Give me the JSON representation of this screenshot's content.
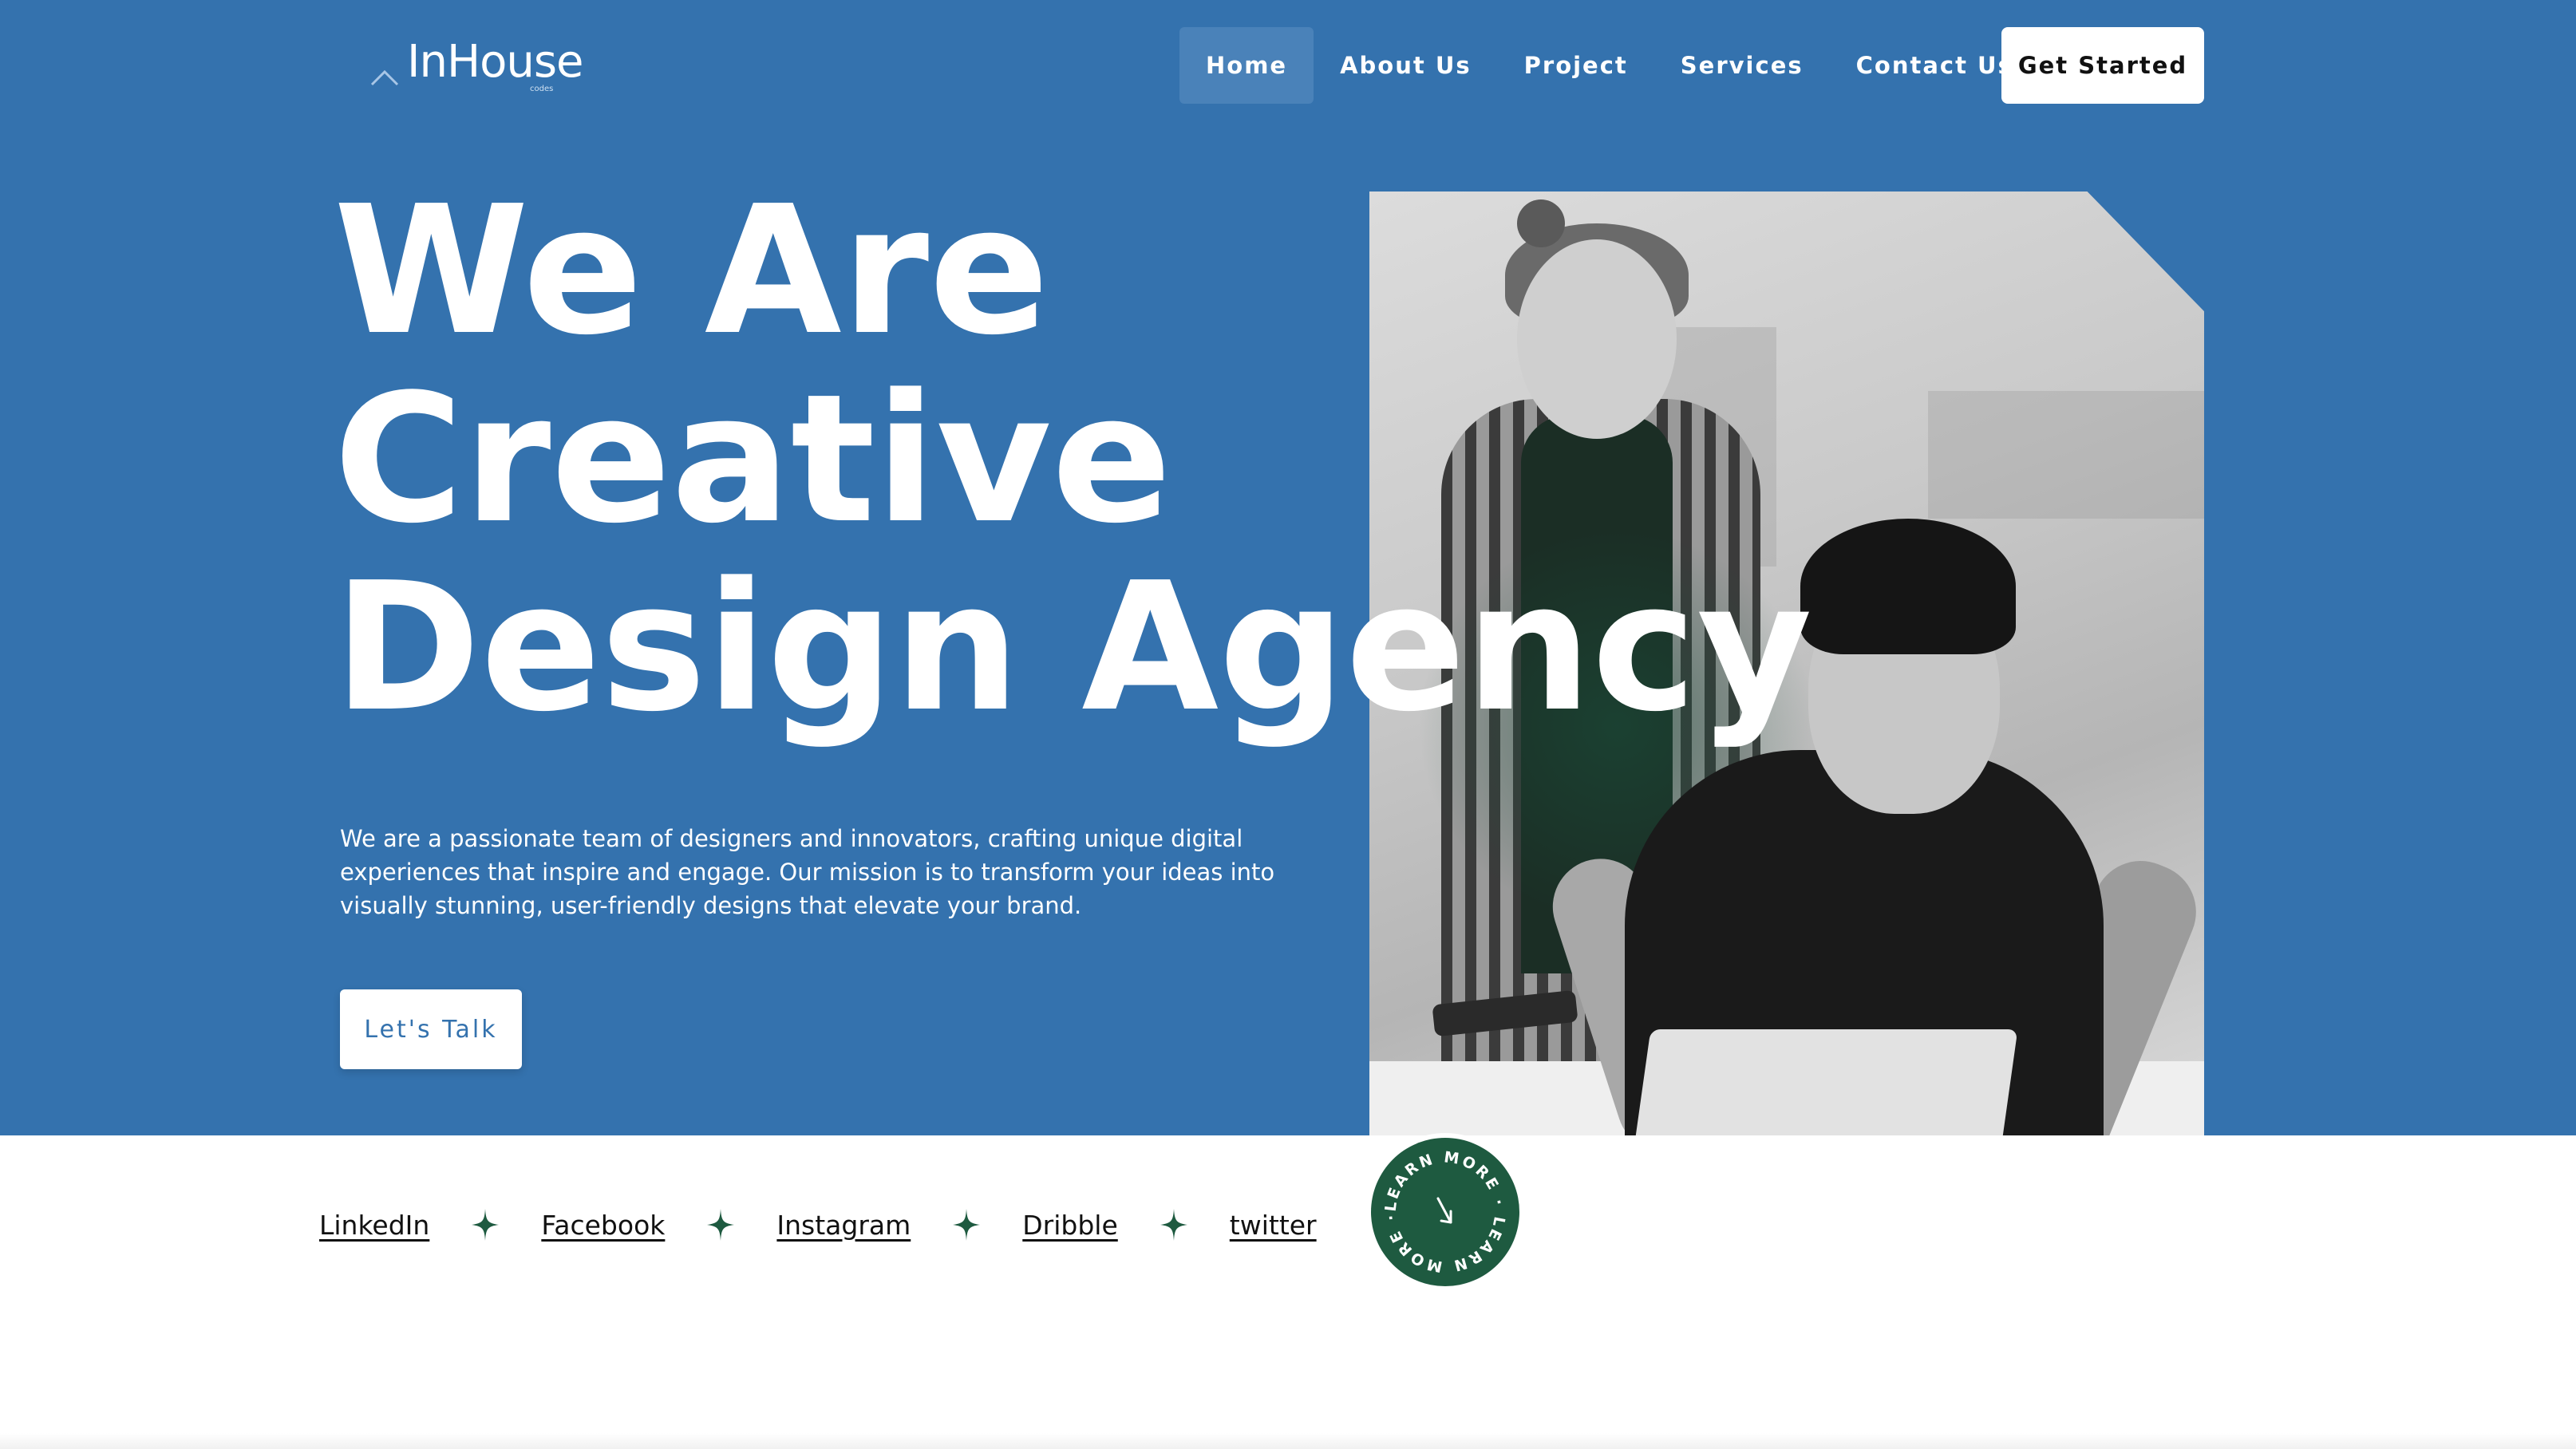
{
  "brand": {
    "name": "InHouse",
    "sub": "codes"
  },
  "nav": {
    "items": [
      {
        "label": "Home",
        "active": true
      },
      {
        "label": "About Us"
      },
      {
        "label": "Project"
      },
      {
        "label": "Services"
      },
      {
        "label": "Contact Us"
      }
    ],
    "cta": "Get Started"
  },
  "hero": {
    "headline": [
      "We Are",
      "Creative",
      "Design Agency"
    ],
    "description": "We are a passionate team of designers and innovators, crafting unique digital experiences that inspire and engage. Our mission is to transform your ideas into visually stunning, user-friendly designs that elevate your brand.",
    "button": "Let's Talk"
  },
  "socials": [
    "LinkedIn",
    "Facebook",
    "Instagram",
    "Dribble",
    "twitter"
  ],
  "badge": {
    "text": "LEARN MORE · LEARN MORE ·"
  },
  "colors": {
    "primary": "#3472ae",
    "accent": "#1e5a40",
    "white": "#ffffff"
  }
}
